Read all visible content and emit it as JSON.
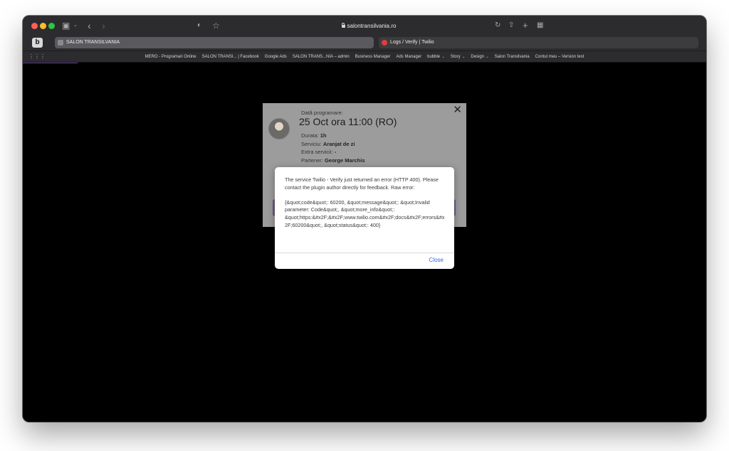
{
  "browser": {
    "address": "salontransilvania.ro",
    "tabs": [
      {
        "label": "SALON TRANSILVANIA",
        "active": true
      },
      {
        "label": "Logs / Verify | Twilio",
        "active": false
      }
    ],
    "bubble_label": "b",
    "bookmarks": [
      {
        "label": "MERO - Programari Online"
      },
      {
        "label": "SALON TRANSI... | Facebook"
      },
      {
        "label": "Google Ads"
      },
      {
        "label": "SALON TRANS...NIA – admin"
      },
      {
        "label": "Business Manager"
      },
      {
        "label": "Ads Manager"
      },
      {
        "label": "bubble",
        "dropdown": true
      },
      {
        "label": "Story",
        "dropdown": true
      },
      {
        "label": "Design",
        "dropdown": true
      },
      {
        "label": "Salon Transilvania"
      },
      {
        "label": "Contul meu – Version test"
      }
    ]
  },
  "booking": {
    "date_label": "Dată programare:",
    "date_value": "25 Oct ora 11:00 (RO)",
    "duration_label": "Durata:",
    "duration_value": "1h",
    "service_label": "Serviciu:",
    "service_value": "Aranjat de zi",
    "extra_label": "Extra servicii:",
    "extra_value": "-",
    "partner_label": "Partener:",
    "partner_value": "George Marchis"
  },
  "dialog": {
    "message": "The service Twilio - Verify just returned an error (HTTP 400). Please contact the plugin author directly for feedback. Raw error:",
    "raw_error": "{&quot;code&quot;: 60200, &quot;message&quot;: &quot;Invalid parameter: Code&quot;, &quot;more_info&quot;: &quot;https:&#x2F;&#x2F;www.twilio.com&#x2F;docs&#x2F;errors&#x2F;60200&quot;, &quot;status&quot;: 400}",
    "close_label": "Close"
  },
  "colors": {
    "link_blue": "#2a6fd6",
    "accent_purple": "#6b3fa0"
  }
}
